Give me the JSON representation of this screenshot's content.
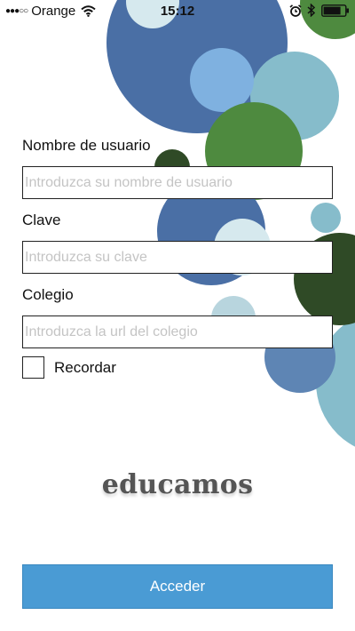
{
  "status_bar": {
    "carrier": "Orange",
    "time": "15:12"
  },
  "form": {
    "username_label": "Nombre de usuario",
    "username_placeholder": "Introduzca su nombre de usuario",
    "username_value": "",
    "password_label": "Clave",
    "password_placeholder": "Introduzca su clave",
    "password_value": "",
    "school_label": "Colegio",
    "school_placeholder": "Introduzca la url del colegio",
    "school_value": "",
    "remember_label": "Recordar",
    "remember_checked": false
  },
  "brand": {
    "logo_text": "educamos"
  },
  "actions": {
    "submit_label": "Acceder",
    "submit_color": "#4a9bd4"
  },
  "colors": {
    "dark_blue": "#4a6fa5",
    "light_blue": "#7fb1e0",
    "teal": "#86bccb",
    "green": "#4e8a3f",
    "dark_green": "#2f4a26"
  },
  "icons": [
    "signal-dots-icon",
    "wifi-icon",
    "alarm-icon",
    "bluetooth-icon",
    "battery-icon"
  ]
}
